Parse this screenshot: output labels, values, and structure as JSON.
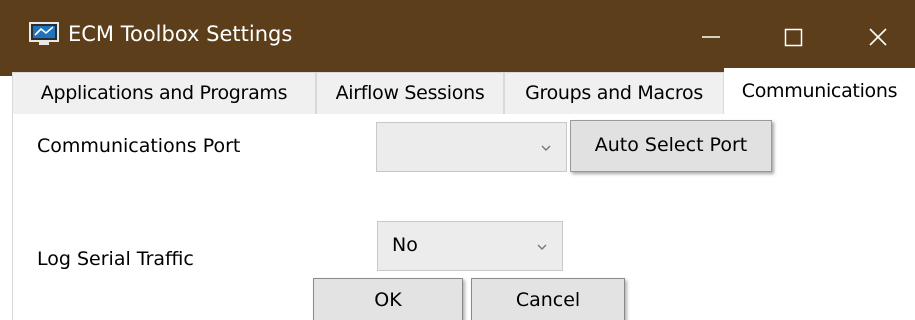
{
  "window": {
    "title": "ECM Toolbox Settings",
    "icon": "computer-monitor-icon",
    "controls": [
      "minimize-icon",
      "maximize-icon",
      "close-icon"
    ],
    "titlebar_color": "#5c3f1a"
  },
  "tabs": [
    {
      "label": "Applications and Programs",
      "active": false
    },
    {
      "label": "Airflow Sessions",
      "active": false
    },
    {
      "label": "Groups and Macros",
      "active": false
    },
    {
      "label": "Communications",
      "active": true
    }
  ],
  "communications": {
    "port_label": "Communications Port",
    "port_value": "",
    "auto_select_label": "Auto Select Port",
    "log_label": "Log Serial Traffic",
    "log_value": "No"
  },
  "footer": {
    "ok_label": "OK",
    "cancel_label": "Cancel"
  }
}
